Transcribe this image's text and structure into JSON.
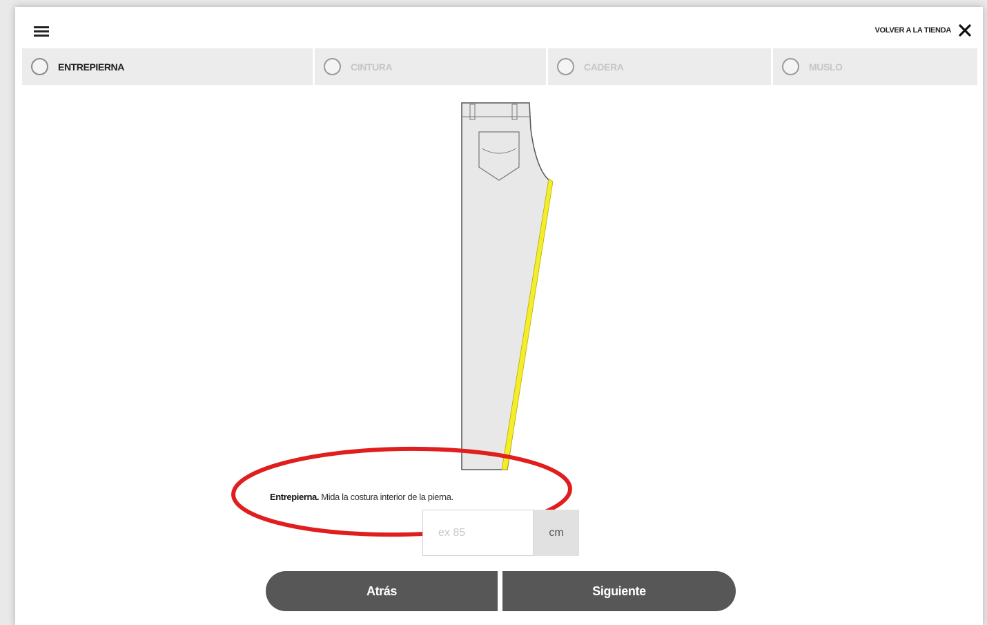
{
  "header": {
    "menu_icon": "hamburger-menu-icon",
    "back_to_store_label": "VOLVER A LA TIENDA",
    "close_icon": "close-icon"
  },
  "tabs": [
    {
      "label": "ENTREPIERNA",
      "active": true
    },
    {
      "label": "CINTURA",
      "active": false
    },
    {
      "label": "CADERA",
      "active": false
    },
    {
      "label": "MUSLO",
      "active": false
    }
  ],
  "illustration": {
    "icon": "pants-inseam-icon",
    "garment_color": "#e8e8e8",
    "tape_color": "#f4ee2a"
  },
  "annotation": {
    "color": "#e01e1e"
  },
  "instruction": {
    "title": "Entrepierna.",
    "text": "Mida la costura interior de la pierna."
  },
  "measurement": {
    "value": "",
    "placeholder": "ex 85",
    "unit": "cm"
  },
  "buttons": {
    "back_label": "Atrás",
    "next_label": "Siguiente",
    "color": "#575757"
  }
}
